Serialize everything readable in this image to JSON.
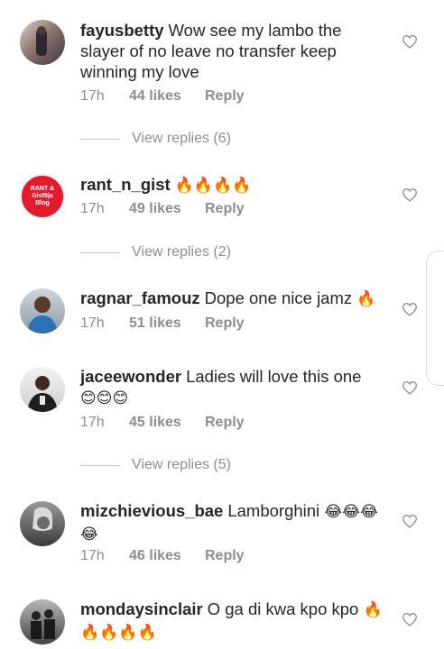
{
  "comments": [
    {
      "username": "fayusbetty",
      "text": "Wow see my lambo the slayer of no leave no transfer keep winning my love",
      "emoji": "",
      "time": "17h",
      "likes": "44 likes",
      "reply": "Reply",
      "view_replies": "View replies (6)"
    },
    {
      "username": "rant_n_gist",
      "text": "",
      "emoji": "🔥🔥🔥🔥",
      "time": "17h",
      "likes": "49 likes",
      "reply": "Reply",
      "view_replies": "View replies (2)",
      "avatar_text": "RANT & Gist9ja Blog"
    },
    {
      "username": "ragnar_famouz",
      "text": "Dope one nice jamz",
      "emoji": "🔥",
      "time": "17h",
      "likes": "51 likes",
      "reply": "Reply"
    },
    {
      "username": "jaceewonder",
      "text": "Ladies will love this one",
      "emoji": "😊😊😊",
      "time": "17h",
      "likes": "45 likes",
      "reply": "Reply",
      "view_replies": "View replies (5)"
    },
    {
      "username": "mizchievious_bae",
      "text": "Lamborghini",
      "emoji": "😂😂😂😂",
      "time": "17h",
      "likes": "46 likes",
      "reply": "Reply"
    },
    {
      "username": "mondaysinclair",
      "text": "O ga di kwa kpo kpo",
      "emoji": "🔥🔥🔥🔥🔥"
    }
  ],
  "colors": {
    "text": "#262626",
    "muted": "#8e8e8e",
    "divider": "#c7c7c7",
    "fire": "#f77f00"
  },
  "icons": {
    "like": "heart-outline-icon"
  }
}
